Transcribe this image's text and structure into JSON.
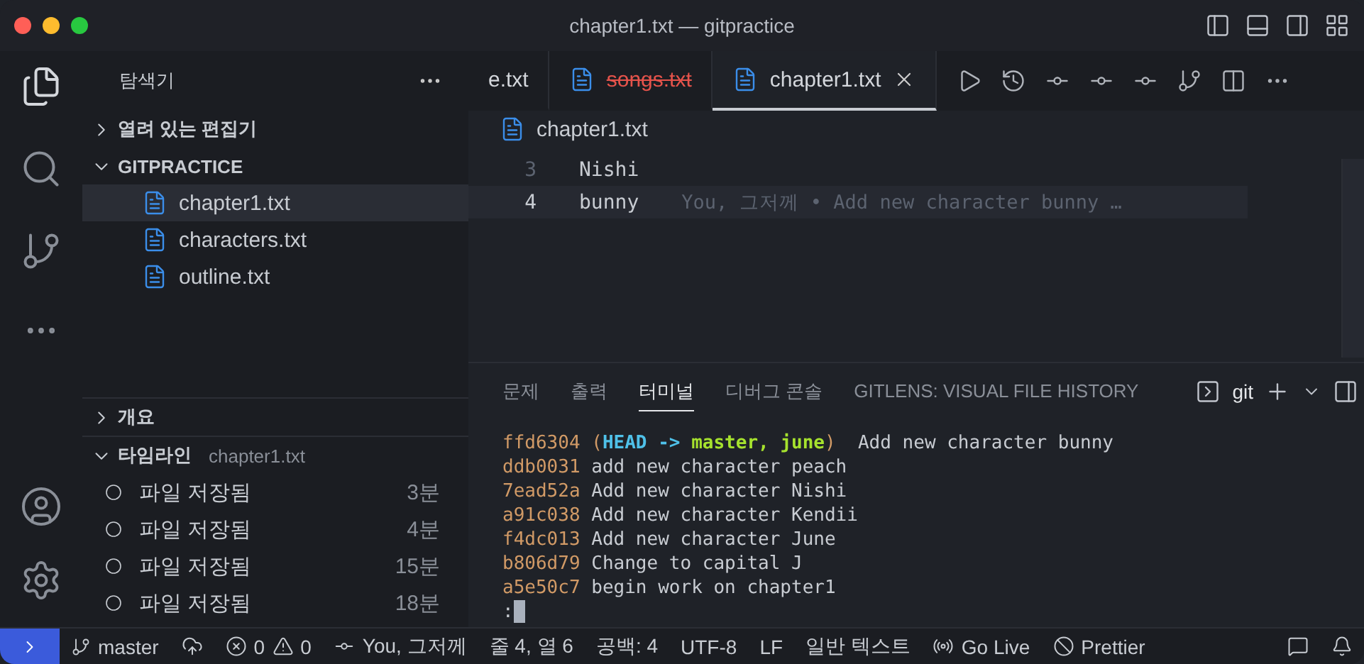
{
  "window": {
    "title": "chapter1.txt — gitpractice"
  },
  "sidebar": {
    "title": "탐색기",
    "open_editors": {
      "label": "열려 있는 편집기",
      "expanded": false
    },
    "workspace": {
      "label": "GITPRACTICE",
      "expanded": true,
      "files": [
        {
          "name": "chapter1.txt",
          "selected": true
        },
        {
          "name": "characters.txt",
          "selected": false
        },
        {
          "name": "outline.txt",
          "selected": false
        }
      ]
    },
    "outline": {
      "label": "개요",
      "expanded": false
    },
    "timeline": {
      "label": "타임라인",
      "file": "chapter1.txt",
      "expanded": true,
      "items": [
        {
          "label": "파일 저장됨",
          "time": "3분"
        },
        {
          "label": "파일 저장됨",
          "time": "4분"
        },
        {
          "label": "파일 저장됨",
          "time": "15분"
        },
        {
          "label": "파일 저장됨",
          "time": "18분"
        }
      ]
    }
  },
  "editor": {
    "tabs": [
      {
        "label": "e.txt",
        "selected": false,
        "deleted": false,
        "icon": false
      },
      {
        "label": "songs.txt",
        "selected": false,
        "deleted": true,
        "icon": true
      },
      {
        "label": "chapter1.txt",
        "selected": true,
        "deleted": false,
        "icon": true
      }
    ],
    "breadcrumb": "chapter1.txt",
    "lines": [
      {
        "number": "3",
        "text": "Nishi",
        "current": false
      },
      {
        "number": "4",
        "text": "bunny",
        "current": true,
        "blame": "You, 그저께 • Add new character bunny …"
      }
    ]
  },
  "panel": {
    "tabs": [
      {
        "label": "문제",
        "selected": false
      },
      {
        "label": "출력",
        "selected": false
      },
      {
        "label": "터미널",
        "selected": true
      },
      {
        "label": "디버그 콘솔",
        "selected": false
      },
      {
        "label": "GITLENS: VISUAL FILE HISTORY",
        "selected": false
      }
    ],
    "terminal_name": "git",
    "log": [
      {
        "hash": "ffd6304",
        "refs": [
          {
            "kind": "paren",
            "text": "("
          },
          {
            "kind": "head",
            "text": "HEAD ->"
          },
          {
            "kind": "branch",
            "text": "master, june"
          },
          {
            "kind": "paren",
            "text": ")"
          }
        ],
        "message": "Add new character bunny"
      },
      {
        "hash": "ddb0031",
        "message": "add new character peach"
      },
      {
        "hash": "7ead52a",
        "message": "Add new character Nishi"
      },
      {
        "hash": "a91c038",
        "message": "Add new character Kendii"
      },
      {
        "hash": "f4dc013",
        "message": "Add new character June"
      },
      {
        "hash": "b806d79",
        "message": "Change to capital J"
      },
      {
        "hash": "a5e50c7",
        "message": "begin work on chapter1"
      }
    ],
    "prompt": ":"
  },
  "status_bar": {
    "branch": "master",
    "errors": "0",
    "warnings": "0",
    "blame": "You, 그저께",
    "position": "줄 4, 열 6",
    "indent": "공백: 4",
    "encoding": "UTF-8",
    "eol": "LF",
    "language": "일반 텍스트",
    "live": "Go Live",
    "formatter": "Prettier"
  }
}
